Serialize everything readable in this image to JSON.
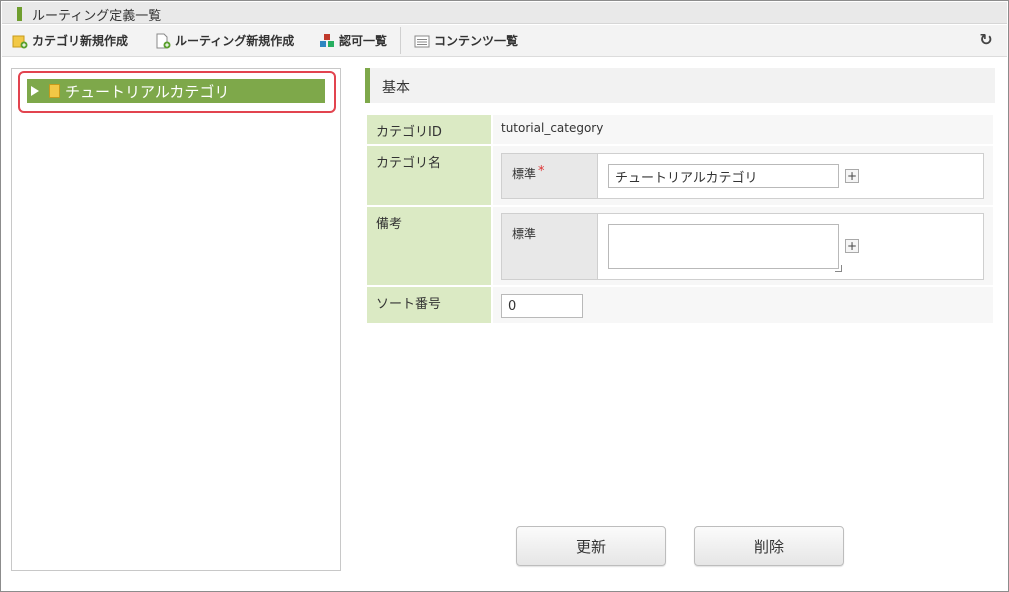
{
  "window": {
    "title": "ルーティング定義一覧"
  },
  "toolbar": {
    "items": [
      {
        "label": "カテゴリ新規作成",
        "icon": "add-category-icon"
      },
      {
        "label": "ルーティング新規作成",
        "icon": "add-document-icon"
      },
      {
        "label": "認可一覧",
        "icon": "blocks-icon"
      },
      {
        "label": "コンテンツ一覧",
        "icon": "list-icon"
      }
    ],
    "refresh_icon": "refresh-icon"
  },
  "tree": {
    "node_label": "チュートリアルカテゴリ"
  },
  "section": {
    "title": "基本"
  },
  "form": {
    "category_id": {
      "label": "カテゴリID",
      "value": "tutorial_category"
    },
    "category_name": {
      "label": "カテゴリ名",
      "sub_label": "標準",
      "required_mark": "*",
      "value": "チュートリアルカテゴリ"
    },
    "remarks": {
      "label": "備考",
      "sub_label": "標準",
      "value": ""
    },
    "sort_number": {
      "label": "ソート番号",
      "value": "0"
    }
  },
  "buttons": {
    "update": "更新",
    "delete": "削除"
  },
  "colors": {
    "accent": "#7ea84a",
    "label_bg": "#dbeac4",
    "highlight": "#e2444f"
  }
}
